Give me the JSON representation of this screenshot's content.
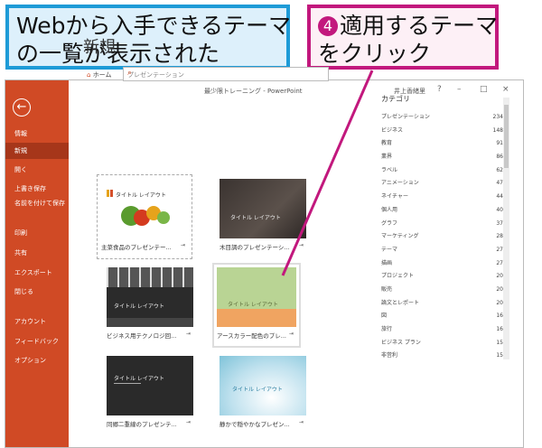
{
  "annotations": {
    "left_line1": "Webから入手できるテーマ",
    "left_line2": "の一覧が表示された",
    "step_number": "4",
    "right_line1": "適用するテーマ",
    "right_line2": "をクリック"
  },
  "titlebar": {
    "title": "最少限トレーニング - PowerPoint",
    "user": "井上香緒里",
    "help": "?",
    "minimize": "–",
    "restore": "□",
    "close": "×"
  },
  "sidebar": {
    "back_glyph": "←",
    "items": [
      {
        "label": "情報"
      },
      {
        "label": "新規"
      },
      {
        "label": "開く"
      },
      {
        "label": "上書き保存"
      },
      {
        "label": "名前を付けて保存"
      },
      {
        "label": "印刷"
      },
      {
        "label": "共有"
      },
      {
        "label": "エクスポート"
      },
      {
        "label": "閉じる"
      },
      {
        "label": "アカウント"
      },
      {
        "label": "フィードバック"
      },
      {
        "label": "オプション"
      }
    ]
  },
  "main": {
    "heading": "新規",
    "home_label": "ホーム",
    "search_value": "プレゼンテーション",
    "templates": [
      {
        "caption": "主菜食品のプレゼンテー...",
        "thumb_title": "タイトル レイアウト"
      },
      {
        "caption": "木目調のプレゼンテーシ...",
        "thumb_title": "タイトル レイアウト"
      },
      {
        "caption": "ビジネス用テクノロジ回...",
        "thumb_title": "タイトル レイアウト"
      },
      {
        "caption": "アースカラー配色のプレ...",
        "thumb_title": "タイトル レイアウト"
      },
      {
        "caption": "同郷二重線のプレゼンテ...",
        "thumb_title": "タイトル レイアウト"
      },
      {
        "caption": "静かで穏やかなプレゼン...",
        "thumb_title": "タイトル レイアウト"
      }
    ]
  },
  "categories": {
    "heading": "カテゴリ",
    "items": [
      {
        "name": "プレゼンテーション",
        "count": "234"
      },
      {
        "name": "ビジネス",
        "count": "148"
      },
      {
        "name": "教育",
        "count": "91"
      },
      {
        "name": "業界",
        "count": "86"
      },
      {
        "name": "ラベル",
        "count": "62"
      },
      {
        "name": "アニメーション",
        "count": "47"
      },
      {
        "name": "ネイチャー",
        "count": "44"
      },
      {
        "name": "個人用",
        "count": "40"
      },
      {
        "name": "グラフ",
        "count": "37"
      },
      {
        "name": "マーケティング",
        "count": "28"
      },
      {
        "name": "テーマ",
        "count": "27"
      },
      {
        "name": "描画",
        "count": "27"
      },
      {
        "name": "プロジェクト",
        "count": "20"
      },
      {
        "name": "販売",
        "count": "20"
      },
      {
        "name": "論文とレポート",
        "count": "20"
      },
      {
        "name": "図",
        "count": "16"
      },
      {
        "name": "旅行",
        "count": "16"
      },
      {
        "name": "ビジネス プラン",
        "count": "15"
      },
      {
        "name": "非営利",
        "count": "15"
      }
    ]
  },
  "colors": {
    "sidebar": "#d04a25",
    "callout_blue": "#1e9bd7",
    "callout_magenta": "#c2187d"
  }
}
